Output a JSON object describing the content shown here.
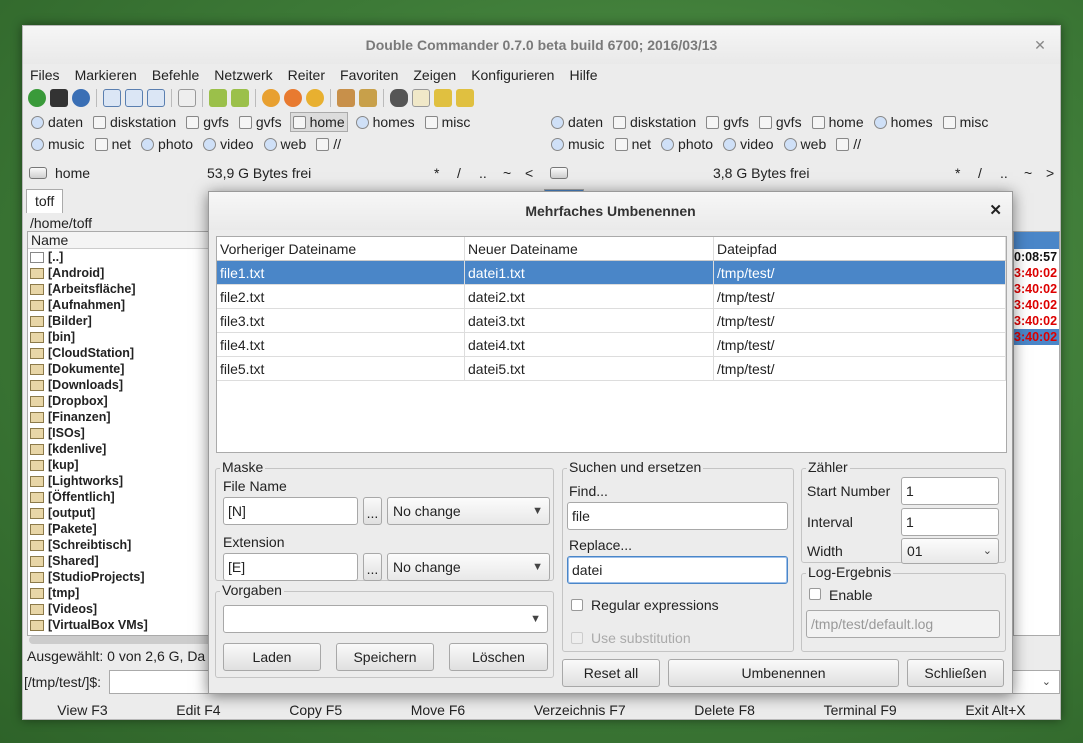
{
  "window_title": "Double Commander 0.7.0 beta build 6700; 2016/03/13",
  "menu": [
    "Files",
    "Markieren",
    "Befehle",
    "Netzwerk",
    "Reiter",
    "Favoriten",
    "Zeigen",
    "Konfigurieren",
    "Hilfe"
  ],
  "left_drives_row1": [
    "daten",
    "diskstation",
    "gvfs",
    "gvfs",
    "home",
    "homes",
    "misc"
  ],
  "left_drives_row2": [
    "music",
    "net",
    "photo",
    "video",
    "web",
    "//"
  ],
  "right_drives_row1": [
    "daten",
    "diskstation",
    "gvfs",
    "gvfs",
    "home",
    "homes",
    "misc"
  ],
  "right_drives_row2": [
    "music",
    "net",
    "photo",
    "video",
    "web",
    "//"
  ],
  "left_panel": {
    "drive": "home",
    "free": "53,9 G Bytes frei",
    "nav": [
      "*",
      "/",
      "..",
      "~",
      "<"
    ],
    "tab": "toff",
    "path": "/home/toff",
    "column_name": "Name"
  },
  "right_panel": {
    "free": "3,8 G Bytes frei",
    "nav": [
      "*",
      "/",
      "..",
      "~",
      ">"
    ]
  },
  "left_files": [
    "[..]",
    "[Android]",
    "[Arbeitsfläche]",
    "[Aufnahmen]",
    "[Bilder]",
    "[bin]",
    "[CloudStation]",
    "[Dokumente]",
    "[Downloads]",
    "[Dropbox]",
    "[Finanzen]",
    "[ISOs]",
    "[kdenlive]",
    "[kup]",
    "[Lightworks]",
    "[Öffentlich]",
    "[output]",
    "[Pakete]",
    "[Schreibtisch]",
    "[Shared]",
    "[StudioProjects]",
    "[tmp]",
    "[Videos]",
    "[VirtualBox VMs]"
  ],
  "right_times": [
    "0:08:57",
    "3:40:02",
    "3:40:02",
    "3:40:02",
    "3:40:02",
    "3:40:02"
  ],
  "status_left": "Ausgewählt: 0 von 2,6 G, Da",
  "cmd_prompt": "[/tmp/test/]$:",
  "fkeys": [
    "View F3",
    "Edit F4",
    "Copy F5",
    "Move F6",
    "Verzeichnis F7",
    "Delete F8",
    "Terminal F9",
    "Exit Alt+X"
  ],
  "dialog": {
    "title": "Mehrfaches Umbenennen",
    "columns": [
      "Vorheriger Dateiname",
      "Neuer Dateiname",
      "Dateipfad"
    ],
    "rows": [
      [
        "file1.txt",
        "datei1.txt",
        "/tmp/test/"
      ],
      [
        "file2.txt",
        "datei2.txt",
        "/tmp/test/"
      ],
      [
        "file3.txt",
        "datei3.txt",
        "/tmp/test/"
      ],
      [
        "file4.txt",
        "datei4.txt",
        "/tmp/test/"
      ],
      [
        "file5.txt",
        "datei5.txt",
        "/tmp/test/"
      ]
    ],
    "mask": {
      "title": "Maske",
      "file_name_label": "File Name",
      "file_name_value": "[N]",
      "file_name_case": "No change",
      "extension_label": "Extension",
      "extension_value": "[E]",
      "extension_case": "No change",
      "browse": "..."
    },
    "search": {
      "title": "Suchen und ersetzen",
      "find_label": "Find...",
      "find_value": "file",
      "replace_label": "Replace...",
      "replace_value": "datei",
      "regex_label": "Regular expressions",
      "subst_label": "Use substitution"
    },
    "counter": {
      "title": "Zähler",
      "start_label": "Start Number",
      "start_value": "1",
      "interval_label": "Interval",
      "interval_value": "1",
      "width_label": "Width",
      "width_value": "01"
    },
    "log": {
      "title": "Log-Ergebnis",
      "enable_label": "Enable",
      "path_placeholder": "/tmp/test/default.log"
    },
    "presets": {
      "title": "Vorgaben",
      "load": "Laden",
      "save": "Speichern",
      "delete": "Löschen"
    },
    "buttons": {
      "reset": "Reset all",
      "rename": "Umbenennen",
      "close": "Schließen"
    }
  }
}
